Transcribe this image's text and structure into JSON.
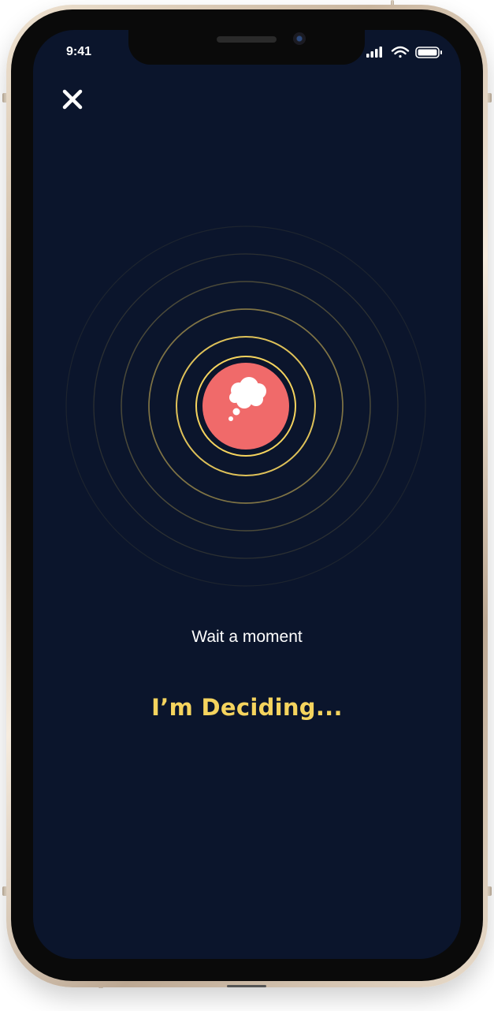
{
  "status_bar": {
    "time": "9:41",
    "icons": [
      "signal-icon",
      "wifi-icon",
      "battery-icon"
    ]
  },
  "toolbar": {
    "close_icon": "close-icon"
  },
  "loader": {
    "icon": "thought-bubble-icon",
    "accent_color": "#f5d45e",
    "center_color": "#f06a6a",
    "background_color": "#0b152c"
  },
  "message": {
    "subtitle": "Wait a moment",
    "title": "I’m Deciding..."
  }
}
